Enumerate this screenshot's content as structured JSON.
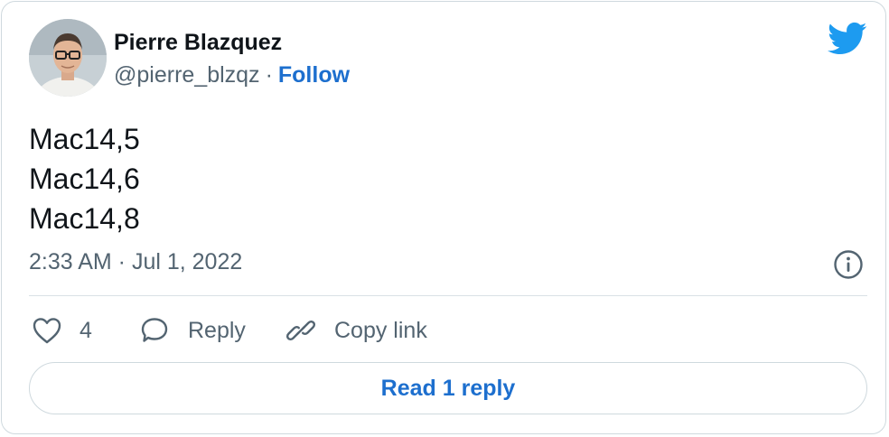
{
  "author": {
    "name": "Pierre Blazquez",
    "handle": "@pierre_blzqz",
    "separator": "·",
    "follow_label": "Follow"
  },
  "tweet": {
    "lines": [
      "Mac14,5",
      "Mac14,6",
      "Mac14,8"
    ]
  },
  "meta": {
    "timestamp": "2:33 AM · Jul 1, 2022"
  },
  "actions": {
    "like_count": "4",
    "reply_label": "Reply",
    "copy_link_label": "Copy link"
  },
  "read_replies_label": "Read 1 reply",
  "icons": {
    "brand": "twitter-bird-icon",
    "info": "info-icon",
    "like": "heart-icon",
    "reply": "speech-bubble-icon",
    "copy": "link-icon"
  },
  "colors": {
    "accent": "#1d9bf0",
    "link": "#1d6fce",
    "text": "#0f1419",
    "muted": "#536471",
    "border": "#cfd9de"
  }
}
